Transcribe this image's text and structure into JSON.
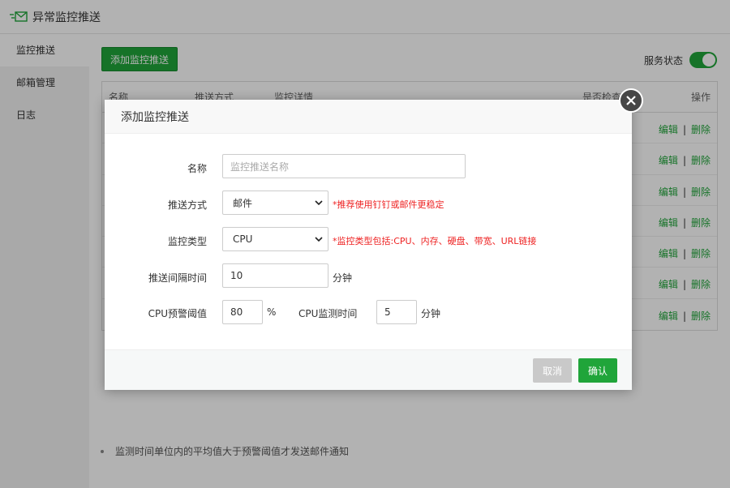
{
  "app": {
    "title": "异常监控推送",
    "icon": "envelope-send-icon"
  },
  "sidebar": {
    "items": [
      {
        "label": "监控推送",
        "active": true
      },
      {
        "label": "邮箱管理",
        "active": false
      },
      {
        "label": "日志",
        "active": false
      }
    ]
  },
  "toolbar": {
    "add_label": "添加监控推送",
    "service_label": "服务状态",
    "service_on": true
  },
  "table": {
    "columns": [
      "名称",
      "推送方式",
      "监控详情",
      "是否检查",
      "操作"
    ],
    "row_actions": {
      "edit": "编辑",
      "sep": "|",
      "delete": "删除"
    },
    "row_count": 7
  },
  "note": "监测时间单位内的平均值大于预警阈值才发送邮件通知",
  "modal": {
    "title": "添加监控推送",
    "fields": {
      "name": {
        "label": "名称",
        "placeholder": "监控推送名称",
        "value": ""
      },
      "push_method": {
        "label": "推送方式",
        "value": "邮件",
        "tip": "*推荐使用钉钉或邮件更稳定"
      },
      "monitor_type": {
        "label": "监控类型",
        "value": "CPU",
        "tip": "*监控类型包括:CPU、内存、硬盘、带宽、URL链接"
      },
      "interval": {
        "label": "推送间隔时间",
        "value": "10",
        "unit": "分钟"
      },
      "cpu_threshold": {
        "label": "CPU预警阈值",
        "value": "80",
        "unit": "%"
      },
      "cpu_time": {
        "label": "CPU监测时间",
        "value": "5",
        "unit": "分钟"
      }
    },
    "cancel_label": "取消",
    "ok_label": "确认"
  },
  "colors": {
    "accent": "#20a53a",
    "tip": "#ee2222"
  }
}
